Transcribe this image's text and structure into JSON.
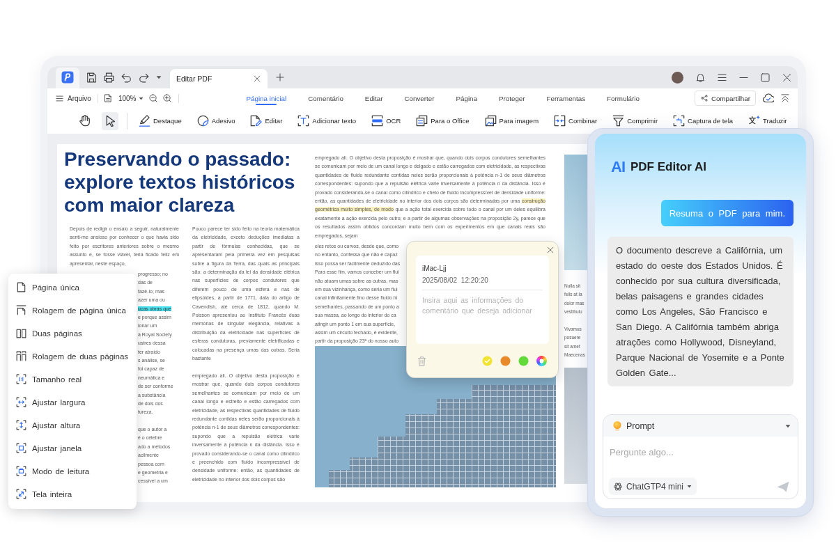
{
  "tab_bar": {
    "tabs": [
      {
        "label": "Editar PDF",
        "selected": true
      }
    ]
  },
  "menu_bar": {
    "file_menu": "Arquivo",
    "zoom": "100%",
    "tabs": [
      {
        "label": "Página inicial",
        "selected": true
      },
      {
        "label": "Comentário",
        "selected": false
      },
      {
        "label": "Editar",
        "selected": false
      },
      {
        "label": "Converter",
        "selected": false
      },
      {
        "label": "Página",
        "selected": false
      },
      {
        "label": "Proteger",
        "selected": false
      },
      {
        "label": "Ferramentas",
        "selected": false
      },
      {
        "label": "Formulário",
        "selected": false
      }
    ],
    "share_button": "Compartilhar"
  },
  "toolbar": {
    "mode_tools": [
      {
        "selected": false
      },
      {
        "selected": true
      }
    ],
    "actions": [
      "Destaque",
      "Adesivo",
      "Editar",
      "Adicionar texto",
      "OCR",
      "Para o Office",
      "Para imagem",
      "Combinar",
      "Comprimir",
      "Captura de tela",
      "Traduzir"
    ]
  },
  "document": {
    "title": "Preservando o passado: explore textos históricos com maior clareza",
    "column_1": {
      "text": "Depois de redigir o ensaio a seguir, naturalmente senti-me ansioso por conhecer o que havia sido feito por escritores anteriores sobre o mesmo assunto e, se fosse viável, teria ficado feliz em apresentar, neste espaço,",
      "fragment_groups": [
        [
          {
            "text": "progresso; no",
            "selected": false
          },
          {
            "text": "das de",
            "selected": false
          },
          {
            "text": "fazê-lo; mas",
            "selected": false
          },
          {
            "text": "azer uma ou",
            "selected": false
          },
          {
            "text": "ucas obras que",
            "selected": true
          },
          {
            "text": "e porque assim",
            "selected": false
          },
          {
            "text": "ionar um",
            "selected": false
          },
          {
            "text": "à Royal Society",
            "selected": false
          },
          {
            "text": "ustres dessa",
            "selected": false
          },
          {
            "text": "ter atraído",
            "selected": false
          },
          {
            "text": "s análise, se",
            "selected": false
          },
          {
            "text": "foi capaz de",
            "selected": false
          },
          {
            "text": "neumática e",
            "selected": false
          },
          {
            "text": "de ser conforme",
            "selected": false
          },
          {
            "text": "a substância",
            "selected": false
          },
          {
            "text": "de dois dos",
            "selected": false
          },
          {
            "text": "tureza.",
            "selected": false
          }
        ],
        [
          {
            "text": "que o autor a",
            "selected": false
          },
          {
            "text": "é o célebre",
            "selected": false
          },
          {
            "text": "ado a métodos",
            "selected": false
          },
          {
            "text": "acilmente",
            "selected": false
          },
          {
            "text": "pessoa com",
            "selected": false
          },
          {
            "text": "e geometria e",
            "selected": false
          },
          {
            "text": "cessível a um",
            "selected": false
          }
        ]
      ]
    },
    "column_2": {
      "paragraphs": [
        "Pouco parece ter sido feito na teoria matemática da eletricidade, exceto deduções imediatas a partir de fórmulas conhecidas, que se apresentaram pela primeira vez em pesquisas sobre a figura da Terra, das quais as principais são: a determinação da lei da densidade elétrica nas superfícies de corpos condutores que diferem pouco de uma esfera e nas de elipsóides, a partir de 1771, data do artigo de Cavendish, até cerca de 1812, quando M. Poisson apresentou ao Instituto Francês duas memórias de singular elegância, relativas à distribuição da eletricidade nas superfícies de esferas condutoras, previamente eletrificadas e colocadas na presença umas das outras. Seria bastante",
        "empregado ali. O objetivo desta proposição é mostrar que, quando dois corpos condutores semelhantes se comunicam por meio de um canal longo e estreito e estão carregados com eletricidade, as respectivas quantidades de fluido redundante contidas neles serão proporcionais à potência n-1 de seus diâmetros correspondentes: supondo que a repulsão elétrica varie inversamente à potência n da distância. Isso é provado considerando-se o canal como cilíndrico e preenchido com fluido incompressível de densidade uniforme: então, as quantidades de eletricidade no interior dos dois corpos são"
      ]
    },
    "column_3": {
      "segments": [
        {
          "text": "empregado ali. O objetivo desta proposição é mostrar que, quando dois corpos condutores semelhantes se comunicam por meio de um canal longo e delgado e estão carregados com eletricidade, as respectivas quantidades de fluido redundante contidas neles serão proporcionais à potência n-1 de seus diâmetros correspondentes: supondo que a repulsão elétrica varie inversamente à potência n da distância. Isso é provado considerando-se o canal como cilíndrico e cheio de fluido incompressível de densidade uniforme: então, as quantidades de eletricidade no interior dos dois corpos são determinadas por uma",
          "highlighted": false
        },
        {
          "text": "construção geométrica muito simples, de modo",
          "highlighted": true
        },
        {
          "text": "que a ação total exercida sobre todo o canal por um deles equilibra exatamente a ação exercida pelo outro; e a partir de algumas observações na proposição 2y, parece que os resultados assim obtidos concordam muito bem com os experimentos em que canais reais são empregados, sejam",
          "highlighted": false
        }
      ],
      "fragments": [
        "eles retos ou curvos, desde que, como",
        "no entanto, confessa que não é capaz",
        "isso possa ser facilmente deduzido das",
        "Para esse fim, vamos conceber um flui",
        "não atuam umas sobre as outras, mas",
        "em sua vizinhança, como seria um flui",
        "canal infinitamente fino desse fluido hi",
        "semelhantes, passando de um ponto a",
        "sua massa, ao longo do interior do ca",
        "atingir um ponto 1 em sua superfície,",
        "assim um circuito fechado, é evidente,",
        "partir da proposição 23ª do nosso auto"
      ]
    },
    "column_4": {
      "fragment_groups": [
        [
          "Nulla sit",
          "felis at la",
          "dolor mas",
          "vestibulu"
        ],
        [
          "Vivamus",
          "posuere",
          "sit amet",
          "Maecenas"
        ]
      ]
    }
  },
  "view_menu": {
    "items": [
      "Página única",
      "Rolagem de página única",
      "Duas páginas",
      "Rolagem de duas páginas",
      "Tamanho real",
      "Ajustar largura",
      "Ajustar altura",
      "Ajustar janela",
      "Modo de leitura",
      "Tela inteira"
    ]
  },
  "comment_popup": {
    "author": "iMac-Ljj",
    "timestamp": "2025/08/02 12:20:20",
    "placeholder": "Insira aqui as informações do comentário que deseja adicionar",
    "colors": [
      {
        "kind": "swatch",
        "color": "#f1e332",
        "selected": true
      },
      {
        "kind": "swatch",
        "color": "#e8892a",
        "selected": false
      },
      {
        "kind": "swatch",
        "color": "#62db3a",
        "selected": false
      },
      {
        "kind": "picker",
        "selected": false
      }
    ]
  },
  "ai_panel": {
    "logo": "AI",
    "title": "PDF Editor AI",
    "user_message": "Resuma o PDF para mim.",
    "reply": "O documento descreve a Califórnia, um estado do oeste dos Estados Unidos. É conhecido por sua cultura diversificada, belas paisagens e grandes cidades como Los Angeles, São Francisco e San Diego. A Califórnia também abriga atrações como Hollywood, Disneyland, Parque Nacional de Yosemite e a Ponte Golden Gate...",
    "prompt": "Prompt",
    "placeholder": "Pergunte algo...",
    "model": "ChatGTP4 mini"
  }
}
